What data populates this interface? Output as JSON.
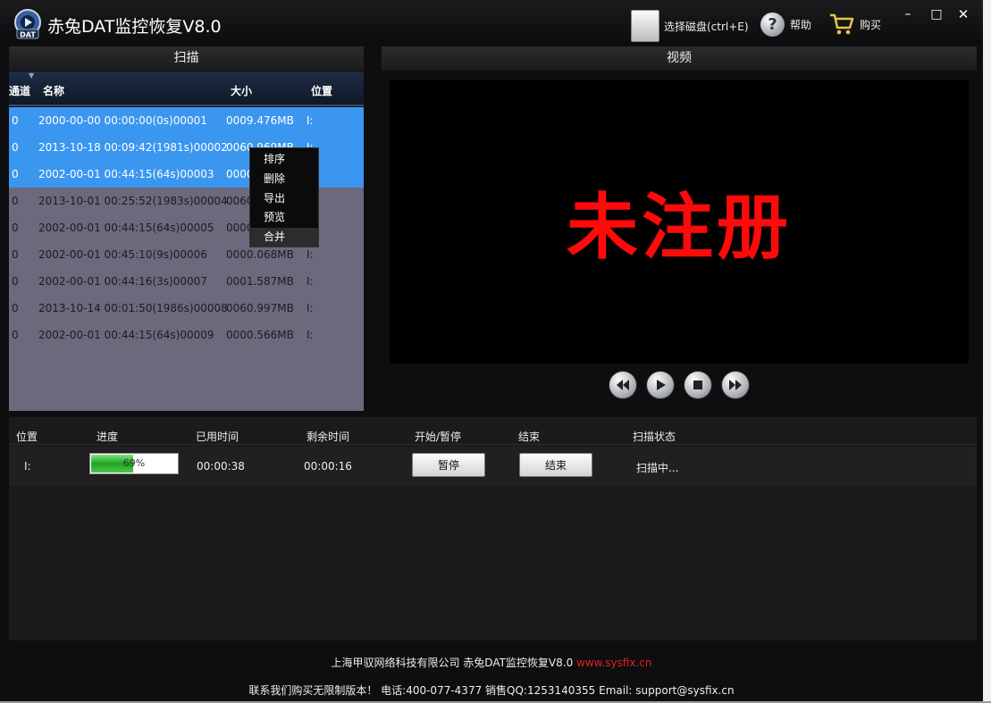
{
  "app": {
    "title": "赤兔DAT监控恢复V8.0",
    "logo_text": "DAT"
  },
  "toolbar": {
    "select_disk": "选择磁盘(ctrl+E)",
    "help": "帮助",
    "buy": "购买"
  },
  "window_controls": {
    "minimize": "–",
    "maximize": "□",
    "close": "✕"
  },
  "scan": {
    "header": "扫描",
    "columns": {
      "channel": "通道",
      "name": "名称",
      "size": "大小",
      "position": "位置"
    },
    "rows": [
      {
        "channel": "0",
        "name": "2000-00-00 00:00:00(0s)00001",
        "size": "0009.476MB",
        "position": "I:"
      },
      {
        "channel": "0",
        "name": "2013-10-18 00:09:42(1981s)00002",
        "size": "0060.969MB",
        "position": "I:"
      },
      {
        "channel": "0",
        "name": "2002-00-01 00:44:15(64s)00003",
        "size": "0000.566MB",
        "position": "I:"
      },
      {
        "channel": "0",
        "name": "2013-10-01 00:25:52(1983s)00004",
        "size": "0060.997MB",
        "position": "I:"
      },
      {
        "channel": "0",
        "name": "2002-00-01 00:44:15(64s)00005",
        "size": "0000.566MB",
        "position": "I:"
      },
      {
        "channel": "0",
        "name": "2002-00-01 00:45:10(9s)00006",
        "size": "0000.068MB",
        "position": "I:"
      },
      {
        "channel": "0",
        "name": "2002-00-01 00:44:16(3s)00007",
        "size": "0001.587MB",
        "position": "I:"
      },
      {
        "channel": "0",
        "name": "2013-10-14 00:01:50(1986s)00008",
        "size": "0060.997MB",
        "position": "I:"
      },
      {
        "channel": "0",
        "name": "2002-00-01 00:44:15(64s)00009",
        "size": "0000.566MB",
        "position": "I:"
      }
    ]
  },
  "context_menu": {
    "items": [
      "排序",
      "删除",
      "导出",
      "预览",
      "合并"
    ]
  },
  "video": {
    "header": "视频",
    "watermark": "未注册"
  },
  "progress": {
    "headers": {
      "position": "位置",
      "progress": "进度",
      "elapsed": "已用时间",
      "remaining": "剩余时间",
      "start_pause": "开始/暂停",
      "end": "结束",
      "status": "扫描状态"
    },
    "position": "I:",
    "percent": 69,
    "percent_label": "69%",
    "elapsed": "00:00:38",
    "remaining": "00:00:16",
    "pause_button": "暂停",
    "end_button": "结束",
    "status": "扫描中..."
  },
  "footer": {
    "company": "上海甲驭网络科技有限公司 赤兔DAT监控恢复V8.0 ",
    "url": "www.sysfix.cn",
    "contact": "联系我们购买无限制版本！ 电话:400-077-4377 销售QQ:1253140355 Email: support@sysfix.cn"
  },
  "colors": {
    "accent_selected": "#3b96f0",
    "watermark": "#ff0a0a",
    "url": "#e0201f",
    "progress_fill": "#1fa41f"
  }
}
